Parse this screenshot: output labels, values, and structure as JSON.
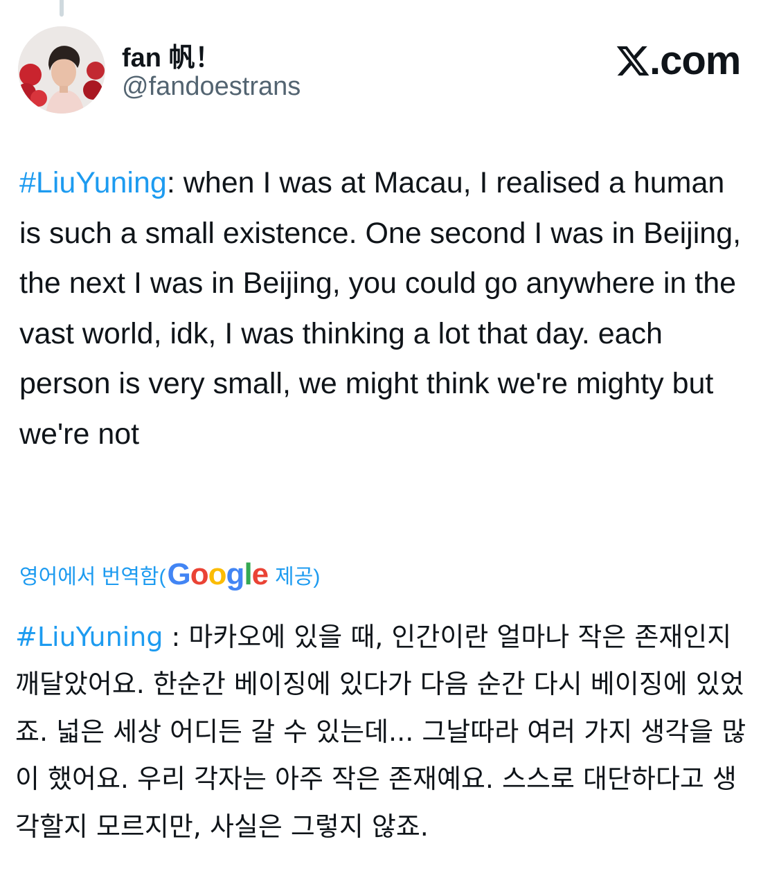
{
  "author": {
    "display_name": "fan 帆！",
    "handle": "@fandoestrans",
    "avatar_icon": "profile-photo"
  },
  "site": {
    "logo_icon": "x-logo-icon",
    "domain": ".com"
  },
  "tweet": {
    "hashtag": "#LiuYuning",
    "body": ": when I was at Macau, I realised a human is such a small existence. One second I was in Beijing, the next I was in Beijing, you could go anywhere in the vast world, idk, I was thinking a lot that day. each person is very small, we might think we're mighty but we're not"
  },
  "translation": {
    "label_prefix": "영어에서 번역함(",
    "provider_letters": [
      "G",
      "o",
      "o",
      "g",
      "l",
      "e"
    ],
    "provider_colors": [
      "#4285f4",
      "#ea4335",
      "#fbbc05",
      "#4285f4",
      "#34a853",
      "#ea4335"
    ],
    "label_suffix": "제공)",
    "hashtag": "#LiuYuning",
    "body": " : 마카오에 있을 때, 인간이란 얼마나 작은 존재인지 깨달았어요. 한순간 베이징에 있다가 다음 순간 다시 베이징에 있었죠. 넓은 세상 어디든 갈 수 있는데... 그날따라 여러 가지 생각을 많이 했어요. 우리 각자는 아주 작은 존재예요. 스스로 대단하다고 생각할지 모르지만, 사실은 그렇지 않죠."
  },
  "colors": {
    "link": "#1d9bf0",
    "text": "#0f1419",
    "secondary": "#536471"
  }
}
